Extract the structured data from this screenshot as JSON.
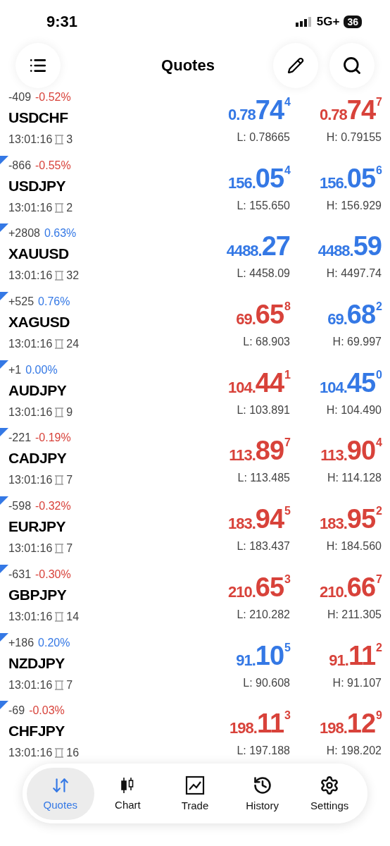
{
  "status_bar": {
    "time": "9:31",
    "network": "5G+",
    "battery": "36"
  },
  "header": {
    "title": "Quotes"
  },
  "quotes": [
    {
      "flag": false,
      "change": "-409",
      "percent": "-0.52%",
      "percent_up": false,
      "symbol": "USDCHF",
      "time": "13:01:16",
      "spread": "3",
      "bid": {
        "prefix": "0.78",
        "big": "74",
        "sup": "4",
        "up": true
      },
      "ask": {
        "prefix": "0.78",
        "big": "74",
        "sup": "7",
        "up": false
      },
      "low": "L: 0.78665",
      "high": "H: 0.79155"
    },
    {
      "flag": true,
      "change": "-866",
      "percent": "-0.55%",
      "percent_up": false,
      "symbol": "USDJPY",
      "time": "13:01:16",
      "spread": "2",
      "bid": {
        "prefix": "156.",
        "big": "05",
        "sup": "4",
        "up": true
      },
      "ask": {
        "prefix": "156.",
        "big": "05",
        "sup": "6",
        "up": true
      },
      "low": "L: 155.650",
      "high": "H: 156.929"
    },
    {
      "flag": true,
      "change": "+2808",
      "percent": "0.63%",
      "percent_up": true,
      "symbol": "XAUUSD",
      "time": "13:01:16",
      "spread": "32",
      "bid": {
        "prefix": "4488.",
        "big": "27",
        "up": true
      },
      "ask": {
        "prefix": "4488.",
        "big": "59",
        "up": true
      },
      "low": "L: 4458.09",
      "high": "H: 4497.74"
    },
    {
      "flag": true,
      "change": "+525",
      "percent": "0.76%",
      "percent_up": true,
      "symbol": "XAGUSD",
      "time": "13:01:16",
      "spread": "24",
      "bid": {
        "prefix": "69.",
        "big": "65",
        "sup": "8",
        "up": false
      },
      "ask": {
        "prefix": "69.",
        "big": "68",
        "sup": "2",
        "up": true
      },
      "low": "L: 68.903",
      "high": "H: 69.997"
    },
    {
      "flag": true,
      "change": "+1",
      "percent": "0.00%",
      "percent_up": true,
      "symbol": "AUDJPY",
      "time": "13:01:16",
      "spread": "9",
      "bid": {
        "prefix": "104.",
        "big": "44",
        "sup": "1",
        "up": false
      },
      "ask": {
        "prefix": "104.",
        "big": "45",
        "sup": "0",
        "up": true
      },
      "low": "L: 103.891",
      "high": "H: 104.490"
    },
    {
      "flag": true,
      "change": "-221",
      "percent": "-0.19%",
      "percent_up": false,
      "symbol": "CADJPY",
      "time": "13:01:16",
      "spread": "7",
      "bid": {
        "prefix": "113.",
        "big": "89",
        "sup": "7",
        "up": false
      },
      "ask": {
        "prefix": "113.",
        "big": "90",
        "sup": "4",
        "up": false
      },
      "low": "L: 113.485",
      "high": "H: 114.128"
    },
    {
      "flag": true,
      "change": "-598",
      "percent": "-0.32%",
      "percent_up": false,
      "symbol": "EURJPY",
      "time": "13:01:16",
      "spread": "7",
      "bid": {
        "prefix": "183.",
        "big": "94",
        "sup": "5",
        "up": false
      },
      "ask": {
        "prefix": "183.",
        "big": "95",
        "sup": "2",
        "up": false
      },
      "low": "L: 183.437",
      "high": "H: 184.560"
    },
    {
      "flag": true,
      "change": "-631",
      "percent": "-0.30%",
      "percent_up": false,
      "symbol": "GBPJPY",
      "time": "13:01:16",
      "spread": "14",
      "bid": {
        "prefix": "210.",
        "big": "65",
        "sup": "3",
        "up": false
      },
      "ask": {
        "prefix": "210.",
        "big": "66",
        "sup": "7",
        "up": false
      },
      "low": "L: 210.282",
      "high": "H: 211.305"
    },
    {
      "flag": true,
      "change": "+186",
      "percent": "0.20%",
      "percent_up": true,
      "symbol": "NZDJPY",
      "time": "13:01:16",
      "spread": "7",
      "bid": {
        "prefix": "91.",
        "big": "10",
        "sup": "5",
        "up": true
      },
      "ask": {
        "prefix": "91.",
        "big": "11",
        "sup": "2",
        "up": false
      },
      "low": "L: 90.608",
      "high": "H: 91.107"
    },
    {
      "flag": true,
      "change": "-69",
      "percent": "-0.03%",
      "percent_up": false,
      "symbol": "CHFJPY",
      "time": "13:01:16",
      "spread": "16",
      "bid": {
        "prefix": "198.",
        "big": "11",
        "sup": "3",
        "up": false
      },
      "ask": {
        "prefix": "198.",
        "big": "12",
        "sup": "9",
        "up": false
      },
      "low": "L: 197.188",
      "high": "H: 198.202"
    }
  ],
  "tab_bar": [
    {
      "kind": "quotes",
      "label": "Quotes",
      "selected": true
    },
    {
      "kind": "chart",
      "label": "Chart",
      "selected": false
    },
    {
      "kind": "trade",
      "label": "Trade",
      "selected": false
    },
    {
      "kind": "history",
      "label": "History",
      "selected": false
    },
    {
      "kind": "settings",
      "label": "Settings",
      "selected": false
    }
  ]
}
